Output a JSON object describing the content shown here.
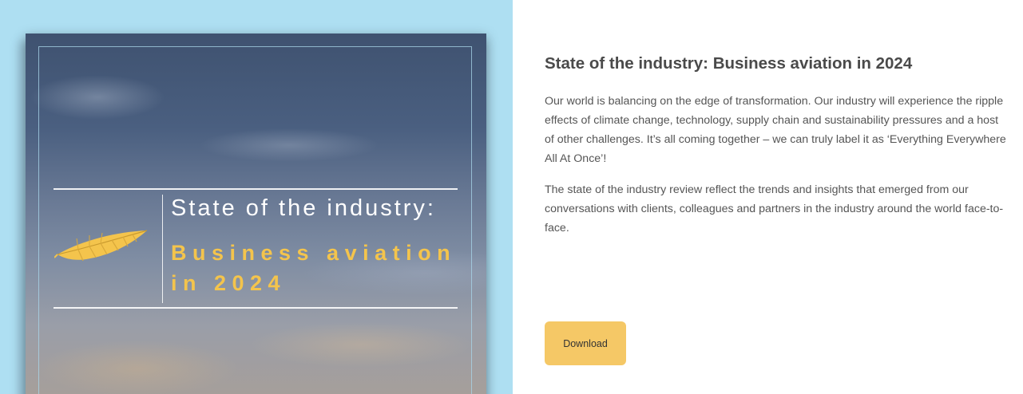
{
  "cover": {
    "title_line1": "State of the industry:",
    "title_line2a": "Business aviation",
    "title_line2b": "in 2024",
    "icon": "feather-icon",
    "colors": {
      "background": "#aedff2",
      "accent": "#f4c44c"
    }
  },
  "content": {
    "heading": "State of the industry: Business aviation in 2024",
    "paragraph1": "Our world is balancing on the edge of transformation. Our industry will experience the ripple effects of climate change, technology, supply chain and sustainability pressures and a host of other challenges. It’s all coming together – we can truly label it as ‘Everything Everywhere All At Once’!",
    "paragraph2": "The state of the industry review reflect the trends and insights that emerged from our conversations with clients, colleagues and partners in the industry around the world face-to-face.",
    "download_label": "Download",
    "colors": {
      "button": "#f5c866",
      "heading": "#4a4a4a",
      "text": "#555555"
    }
  }
}
